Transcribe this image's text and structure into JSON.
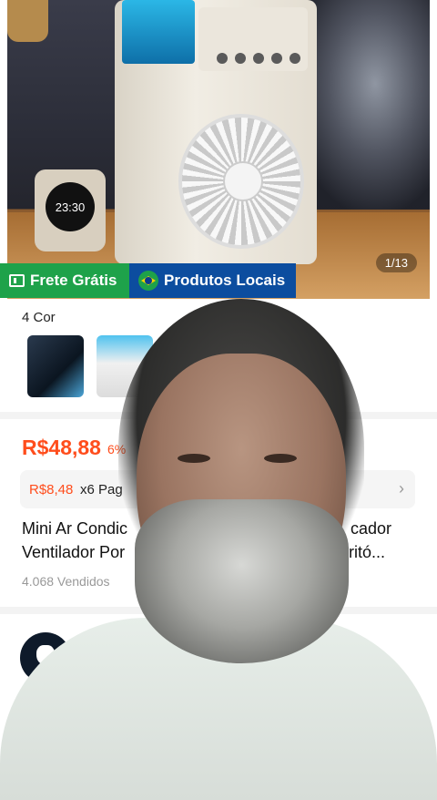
{
  "hero": {
    "clock_time": "23:30",
    "image_counter": "1/13"
  },
  "badges": {
    "free_shipping": "Frete Grátis",
    "local_products": "Produtos Locais"
  },
  "variants": {
    "label": "4 Cor"
  },
  "pricing": {
    "price": "R$48,88",
    "discount": "6%",
    "installment_amount": "R$8,48",
    "installment_text": "x6 Pag"
  },
  "product": {
    "title_line1_left": "Mini Ar Condic",
    "title_line1_right": "cador",
    "title_line2_left": "Ventilador Por",
    "title_line2_right": "ritó...",
    "sold": "4.068 Vendidos"
  },
  "colors": {
    "accent": "#ff4d1c",
    "green_badge": "#1ea24a",
    "blue_badge": "#0c4d9f"
  }
}
